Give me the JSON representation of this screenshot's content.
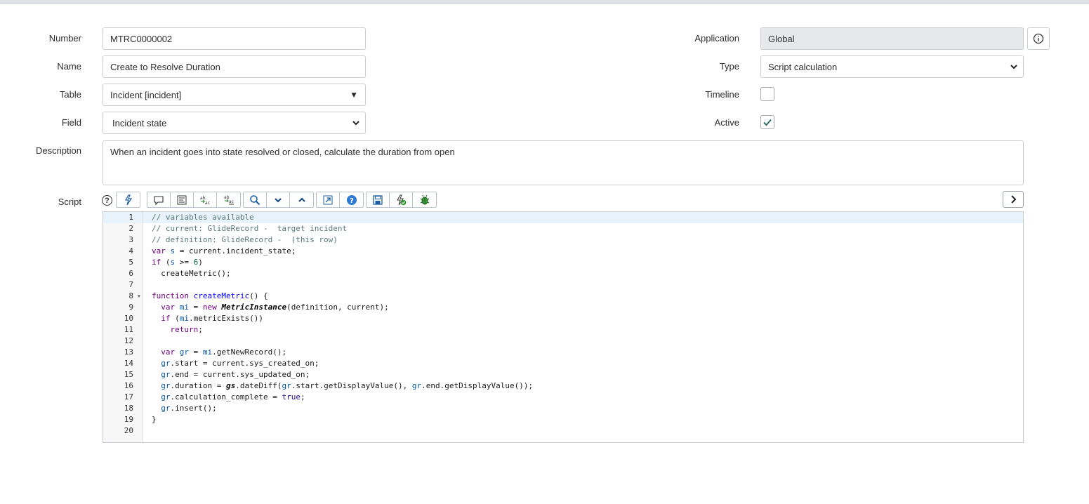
{
  "form": {
    "number": {
      "label": "Number",
      "value": "MTRC0000002"
    },
    "name": {
      "label": "Name",
      "value": "Create to Resolve Duration"
    },
    "table": {
      "label": "Table",
      "value": "Incident [incident]"
    },
    "field": {
      "label": "Field",
      "value": "Incident state"
    },
    "description": {
      "label": "Description",
      "value": "When an incident goes into state resolved or closed, calculate the duration from open"
    },
    "application": {
      "label": "Application",
      "value": "Global"
    },
    "type": {
      "label": "Type",
      "value": "Script calculation"
    },
    "timeline": {
      "label": "Timeline",
      "checked": false
    },
    "active": {
      "label": "Active",
      "checked": true
    },
    "script": {
      "label": "Script"
    }
  },
  "toolbar": {
    "groups": [
      [
        "toggle-syntax-icon"
      ],
      [
        "comment-icon",
        "format-icon",
        "replace-icon",
        "replace-all-icon"
      ],
      [
        "search-icon",
        "next-icon",
        "previous-icon"
      ],
      [
        "fullscreen-icon",
        "help-icon"
      ],
      [
        "save-icon",
        "check-syntax-icon",
        "debug-icon"
      ]
    ]
  },
  "editor": {
    "line_numbers": [
      "1",
      "2",
      "3",
      "4",
      "5",
      "6",
      "7",
      "8",
      "9",
      "10",
      "11",
      "12",
      "13",
      "14",
      "15",
      "16",
      "17",
      "18",
      "19",
      "20"
    ],
    "lines": [
      "// variables available",
      "// current: GlideRecord -  target incident",
      "// definition: GlideRecord -  (this row)",
      "var s = current.incident_state;",
      "if (s >= 6)",
      "  createMetric();",
      "",
      "function createMetric() {",
      "  var mi = new MetricInstance(definition, current);",
      "  if (mi.metricExists())",
      "    return;",
      "",
      "  var gr = mi.getNewRecord();",
      "  gr.start = current.sys_created_on;",
      "  gr.end = current.sys_updated_on;",
      "  gr.duration = gs.dateDiff(gr.start.getDisplayValue(), gr.end.getDisplayValue());",
      "  gr.calculation_complete = true;",
      "  gr.insert();",
      "}",
      ""
    ]
  },
  "colors": {
    "accent": "#2e6e5e",
    "border": "#c9ced3",
    "readonly_bg": "#e6e8ea",
    "active_line": "#e8f2fb"
  }
}
